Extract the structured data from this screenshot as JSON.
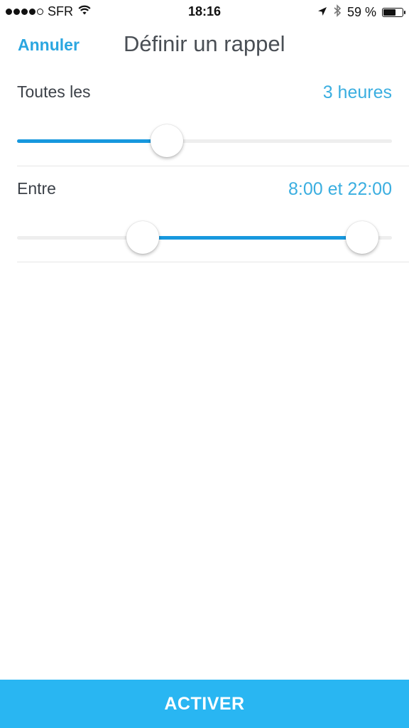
{
  "status_bar": {
    "carrier": "SFR",
    "signal_bars_filled": 4,
    "signal_bars_total": 5,
    "time": "18:16",
    "battery_text": "59 %",
    "battery_level": 0.59,
    "icons": [
      "signal-dots-icon",
      "wifi-icon",
      "location-arrow-icon",
      "bluetooth-icon",
      "battery-icon"
    ]
  },
  "nav": {
    "cancel_label": "Annuler",
    "title": "Définir un rappel"
  },
  "interval": {
    "label": "Toutes les",
    "value": "3 heures",
    "slider_position": 0.4
  },
  "range": {
    "label": "Entre",
    "value": "8:00 et 22:00",
    "start_position": 0.335,
    "end_position": 0.92
  },
  "footer": {
    "activate_label": "ACTIVER"
  },
  "colors": {
    "accent": "#2aa6e0",
    "slider_fill": "#1798de",
    "button_bg": "#29b6f2"
  }
}
